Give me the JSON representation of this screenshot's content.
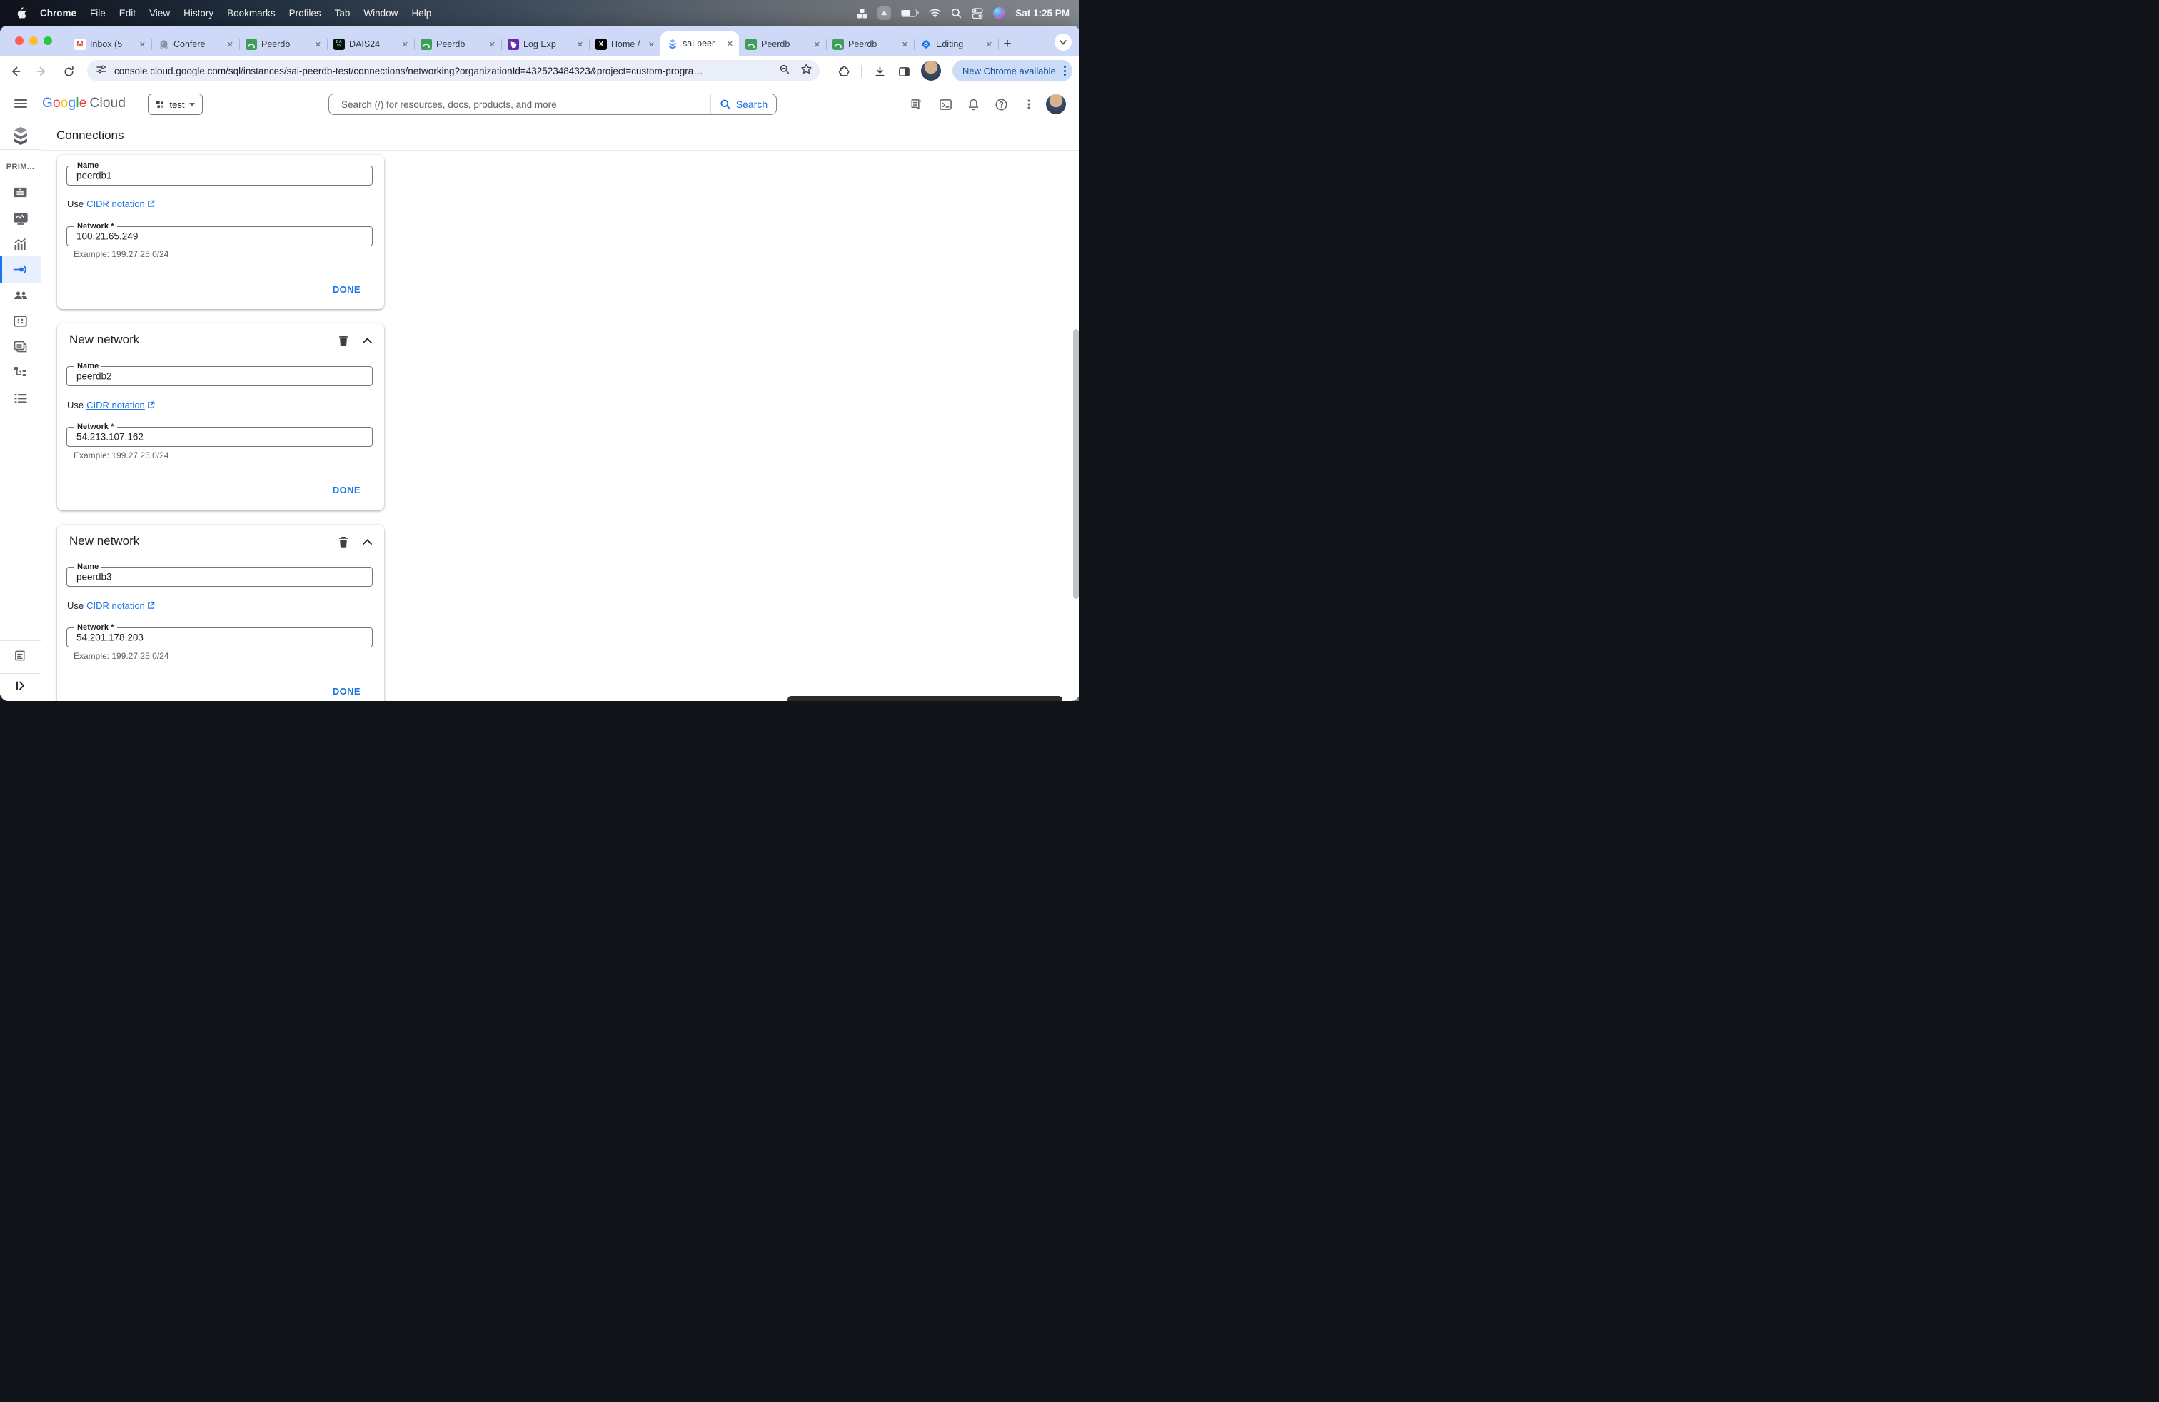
{
  "os": {
    "menu_items": [
      "Chrome",
      "File",
      "Edit",
      "View",
      "History",
      "Bookmarks",
      "Profiles",
      "Tab",
      "Window",
      "Help"
    ],
    "clock": "Sat 1:25 PM",
    "status_icons": [
      "window-tiling-icon",
      "screen-recorder-icon",
      "battery-icon",
      "wifi-icon",
      "spotlight-icon",
      "control-center-icon",
      "siri-icon"
    ]
  },
  "browser": {
    "tabs": [
      {
        "title": "Inbox (5",
        "favicon": "gmail"
      },
      {
        "title": "Confere",
        "favicon": "postgresql"
      },
      {
        "title": "Peerdb",
        "favicon": "peerdb"
      },
      {
        "title": "DAIS24",
        "favicon": "dais24"
      },
      {
        "title": "Peerdb",
        "favicon": "peerdb"
      },
      {
        "title": "Log Exp",
        "favicon": "datadog"
      },
      {
        "title": "Home /",
        "favicon": "x-twitter"
      },
      {
        "title": "sai-peer",
        "favicon": "cloud-sql",
        "active": true
      },
      {
        "title": "Peerdb",
        "favicon": "peerdb"
      },
      {
        "title": "Peerdb",
        "favicon": "peerdb"
      },
      {
        "title": "Editing",
        "favicon": "blue-diamond"
      }
    ],
    "new_tab_label": "+",
    "url": "console.cloud.google.com/sql/instances/sai-peerdb-test/connections/networking?organizationId=432523484323&project=custom-progra…",
    "update_chip": "New Chrome available",
    "dais_line1": "DA",
    "dais_line2": "IS",
    "x_glyph": "X",
    "gmail_glyph": "M"
  },
  "gc_header": {
    "brand_google": "Google",
    "brand_cloud": "Cloud",
    "project": "test",
    "search_placeholder": "Search (/) for resources, docs, products, and more",
    "search_button": "Search"
  },
  "sidebar": {
    "section_label": "PRIM...",
    "items": [
      "overview",
      "system-insights",
      "query-insights",
      "connections",
      "users",
      "databases",
      "backups",
      "replicas",
      "operations"
    ],
    "active_item": "connections"
  },
  "page": {
    "title": "Connections",
    "cards": [
      {
        "name_label": "Name",
        "name_value": "peerdb1",
        "use_prefix": "Use",
        "cidr_link_text": "CIDR notation",
        "network_label": "Network *",
        "network_value": "100.21.65.249",
        "example": "Example: 199.27.25.0/24",
        "done_label": "DONE"
      },
      {
        "header": "New network",
        "name_label": "Name",
        "name_value": "peerdb2",
        "use_prefix": "Use",
        "cidr_link_text": "CIDR notation",
        "network_label": "Network *",
        "network_value": "54.213.107.162",
        "example": "Example: 199.27.25.0/24",
        "done_label": "DONE"
      },
      {
        "header": "New network",
        "name_label": "Name",
        "name_value": "peerdb3",
        "use_prefix": "Use",
        "cidr_link_text": "CIDR notation",
        "network_label": "Network *",
        "network_value": "54.201.178.203",
        "example": "Example: 199.27.25.0/24",
        "done_label": "DONE"
      }
    ]
  },
  "colors": {
    "accent": "#1a73e8",
    "link": "#1a73e8",
    "tabstrip_bg": "#cdd9f6",
    "update_chip_bg": "#cbdcf9",
    "update_chip_text": "#17479e",
    "active_nav_bg": "#e8f0fe",
    "header_border": "#dadce0"
  }
}
